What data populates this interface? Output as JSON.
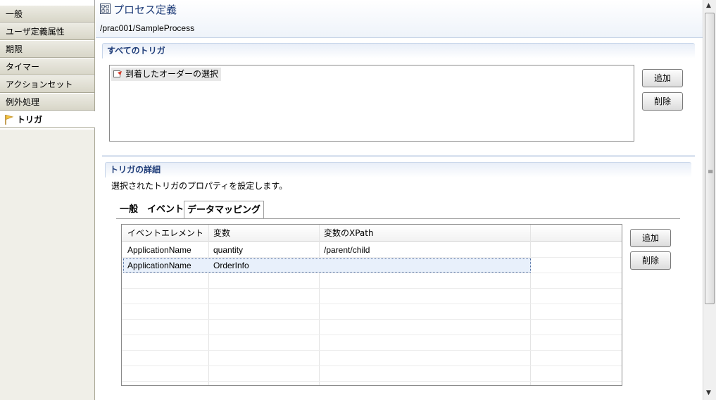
{
  "sidebar": {
    "items": [
      {
        "label": "一般"
      },
      {
        "label": "ユーザ定義属性"
      },
      {
        "label": "期限"
      },
      {
        "label": "タイマー"
      },
      {
        "label": "アクションセット"
      },
      {
        "label": "例外処理"
      },
      {
        "label": "トリガ",
        "active": true
      }
    ]
  },
  "header": {
    "title": "プロセス定義",
    "path": "/prac001/SampleProcess"
  },
  "all_triggers": {
    "section_title": "すべてのトリガ",
    "items": [
      {
        "label": "到着したオーダーの選択"
      }
    ],
    "add_label": "追加",
    "delete_label": "削除"
  },
  "trigger_details": {
    "section_title": "トリガの詳細",
    "description": "選択されたトリガのプロパティを設定します。",
    "tabs": [
      {
        "label": "一般"
      },
      {
        "label": "イベント"
      },
      {
        "label": "データマッピング",
        "selected": true
      }
    ],
    "table": {
      "columns": [
        "イベントエレメント",
        "変数",
        "変数のXPath",
        ""
      ],
      "rows": [
        [
          "ApplicationName",
          "quantity",
          "/parent/child"
        ],
        [
          "ApplicationName",
          "OrderInfo",
          ""
        ]
      ],
      "selected_row": 1
    },
    "add_label": "追加",
    "delete_label": "削除"
  },
  "scrollbar": {
    "grip": "≡",
    "up": "▲",
    "down": "▼"
  }
}
